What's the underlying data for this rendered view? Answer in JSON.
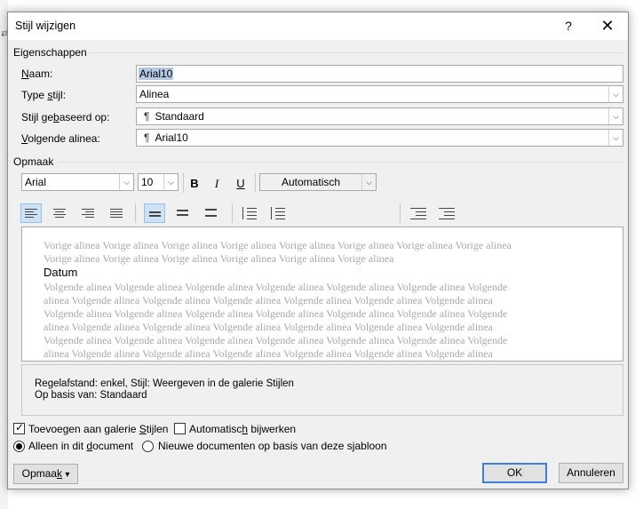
{
  "background": {
    "mark": "⇄"
  },
  "dialog": {
    "title": "Stijl wijzigen",
    "help_label": "?",
    "close_label": "✕"
  },
  "properties": {
    "section_label": "Eigenschappen",
    "name_label": "Naam:",
    "name_value": "Arial10",
    "style_type_label": "Type stijl:",
    "style_type_value": "Alinea",
    "based_on_label": "Stijl gebaseerd op:",
    "based_on_value": "Standaard",
    "next_para_label": "Volgende alinea:",
    "next_para_value": "Arial10",
    "pilcrow": "¶"
  },
  "format": {
    "section_label": "Opmaak",
    "font": "Arial",
    "size": "10",
    "bold_label": "B",
    "italic_label": "I",
    "underline_label": "U",
    "color": "Automatisch"
  },
  "preview": {
    "previous_lines": [
      "Vorige alinea Vorige alinea Vorige alinea Vorige alinea Vorige alinea Vorige alinea Vorige alinea Vorige alinea",
      "Vorige alinea Vorige alinea Vorige alinea Vorige alinea Vorige alinea Vorige alinea"
    ],
    "sample": "Datum",
    "next_lines": [
      "Volgende alinea Volgende alinea Volgende alinea Volgende alinea Volgende alinea Volgende alinea Volgende",
      "alinea Volgende alinea Volgende alinea Volgende alinea Volgende alinea Volgende alinea Volgende alinea",
      "Volgende alinea Volgende alinea Volgende alinea Volgende alinea Volgende alinea Volgende alinea Volgende",
      "alinea Volgende alinea Volgende alinea Volgende alinea Volgende alinea Volgende alinea Volgende alinea",
      "Volgende alinea Volgende alinea Volgende alinea Volgende alinea Volgende alinea Volgende alinea Volgende",
      "alinea Volgende alinea Volgende alinea Volgende alinea Volgende alinea Volgende alinea Volgende alinea"
    ]
  },
  "description": {
    "line1": "Regelafstand:  enkel, Stijl: Weergeven in de galerie Stijlen",
    "line2": "Op basis van: Standaard"
  },
  "options": {
    "add_gallery_label": "Toevoegen aan galerie Stijlen",
    "add_gallery_checked": true,
    "auto_update_label": "Automatisch bijwerken",
    "auto_update_checked": false,
    "only_doc_label": "Alleen in dit document",
    "new_docs_label": "Nieuwe documenten op basis van deze sjabloon",
    "checkmark": "✓"
  },
  "buttons": {
    "format_label": "Opmaak",
    "format_arrow": "▾",
    "ok_label": "OK",
    "cancel_label": "Annuleren"
  },
  "icons": {
    "dropdown": "⌵"
  },
  "colors": {
    "selection": "#b5c9e5",
    "active_button": "#cde2f7",
    "default_border": "#3c7fd7"
  }
}
